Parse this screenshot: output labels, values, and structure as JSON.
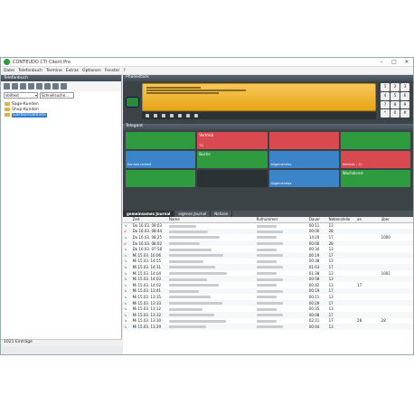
{
  "window": {
    "title": "CONTEUDO CTI Client Pro"
  },
  "menu": [
    "Datei",
    "Telefonbuch",
    "Termine",
    "Extras",
    "Optionen",
    "Fenster",
    "?"
  ],
  "left_panel": {
    "header": "Telefonbuch",
    "filter_select": "Volltext",
    "search_placeholder": "Schnellsuche...",
    "tree": [
      "Sage-Kunden",
      "Shop-Kunden",
      "Gastkontaktliste"
    ],
    "status": "1021 Einträge"
  },
  "phone_panel": {
    "header": "Phonestack",
    "keypad": [
      "1",
      "2",
      "3",
      "4",
      "5",
      "6",
      "7",
      "8",
      "9",
      "*",
      "0",
      "#"
    ]
  },
  "tel_panel": {
    "header": "Telegant",
    "tiles": [
      {
        "color": "g",
        "title": "",
        "sub": ""
      },
      {
        "color": "r",
        "title": "Vertrieb",
        "sub": "74"
      },
      {
        "color": "r",
        "title": "",
        "sub": ""
      },
      {
        "color": "g",
        "title": "",
        "sub": ""
      },
      {
        "color": "b",
        "title": "",
        "sub": "Sonnen-rocked"
      },
      {
        "color": "g",
        "title": "Buche",
        "sub": ""
      },
      {
        "color": "b",
        "title": "",
        "sub": "Allgemeinfax"
      },
      {
        "color": "r",
        "title": "",
        "sub": "Vertrieb - 12"
      },
      {
        "color": "g",
        "title": "",
        "sub": ""
      },
      {
        "color": "d",
        "title": "",
        "sub": ""
      },
      {
        "color": "b",
        "title": "",
        "sub": "Allgemeinfax"
      },
      {
        "color": "g",
        "title": "Wachdienst",
        "sub": ""
      }
    ]
  },
  "journal": {
    "tabs": [
      "gemeinsames Journal",
      "eigenes Journal",
      "Notizen"
    ],
    "columns": [
      "",
      "Zeit",
      "Name",
      "Rufnummer",
      "Dauer",
      "Nebenstelle",
      "an",
      "über"
    ],
    "rows": [
      {
        "dir": "in",
        "zeit": "Do 16.03. 09:03",
        "dauer": "00:11",
        "neben": "13",
        "an": "",
        "ueber": ""
      },
      {
        "dir": "miss",
        "zeit": "Do 16.03. 08:44",
        "dauer": "00:00",
        "neben": "28",
        "an": "",
        "ueber": ""
      },
      {
        "dir": "in",
        "zeit": "Do 16.03. 08:25",
        "dauer": "14:20",
        "neben": "17",
        "an": "",
        "ueber": "1000"
      },
      {
        "dir": "miss",
        "zeit": "Do 16.03. 08:02",
        "dauer": "00:00",
        "neben": "28",
        "an": "",
        "ueber": ""
      },
      {
        "dir": "in",
        "zeit": "Do 16.03. 07:58",
        "dauer": "00:34",
        "neben": "13",
        "an": "",
        "ueber": ""
      },
      {
        "dir": "in",
        "zeit": "Mi 15.03. 16:06",
        "dauer": "00:19",
        "neben": "17",
        "an": "",
        "ueber": ""
      },
      {
        "dir": "in",
        "zeit": "Mi 15.03. 14:55",
        "dauer": "00:38",
        "neben": "13",
        "an": "",
        "ueber": ""
      },
      {
        "dir": "in",
        "zeit": "Mi 15.03. 14:31",
        "dauer": "01:03",
        "neben": "17",
        "an": "",
        "ueber": ""
      },
      {
        "dir": "in",
        "zeit": "Mi 15.03. 14:04",
        "dauer": "01:38",
        "neben": "13",
        "an": "",
        "ueber": "1001"
      },
      {
        "dir": "in",
        "zeit": "Mi 15.03. 14:03",
        "dauer": "00:58",
        "neben": "13",
        "an": "",
        "ueber": ""
      },
      {
        "dir": "in",
        "zeit": "Mi 15.03. 14:02",
        "dauer": "00:42",
        "neben": "13",
        "an": "17",
        "ueber": ""
      },
      {
        "dir": "in",
        "zeit": "Mi 15.03. 13:41",
        "dauer": "00:19",
        "neben": "17",
        "an": "",
        "ueber": ""
      },
      {
        "dir": "in",
        "zeit": "Mi 15.03. 13:35",
        "dauer": "00:11",
        "neben": "13",
        "an": "",
        "ueber": ""
      },
      {
        "dir": "in",
        "zeit": "Mi 15.03. 13:33",
        "dauer": "00:29",
        "neben": "17",
        "an": "",
        "ueber": ""
      },
      {
        "dir": "in",
        "zeit": "Mi 15.03. 13:32",
        "dauer": "00:35",
        "neben": "13",
        "an": "",
        "ueber": ""
      },
      {
        "dir": "in",
        "zeit": "Mi 15.03. 13:32",
        "dauer": "00:08",
        "neben": "17",
        "an": "",
        "ueber": ""
      },
      {
        "dir": "in",
        "zeit": "Mi 15.03. 13:30",
        "dauer": "02:21",
        "neben": "17",
        "an": "28",
        "ueber": "28"
      },
      {
        "dir": "in",
        "zeit": "Mi 15.03. 13:29",
        "dauer": "00:44",
        "neben": "13",
        "an": "",
        "ueber": ""
      }
    ]
  }
}
